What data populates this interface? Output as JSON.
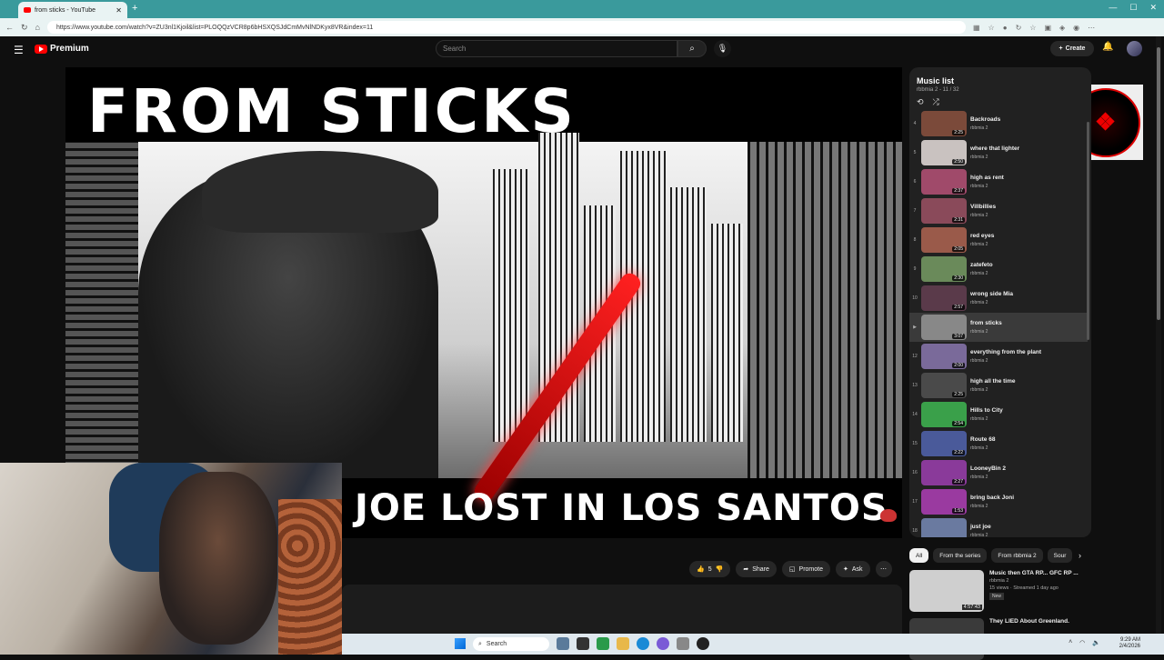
{
  "browser": {
    "tab_title": "from sticks - YouTube",
    "url": "https://www.youtube.com/watch?v=ZU3nl1Kjoil&list=PLOQQzVCR8p6bHSXQSJdCmMvNlNDKyx8VR&index=11"
  },
  "header": {
    "brand": "Premium",
    "search_placeholder": "Search",
    "create_label": "Create"
  },
  "video": {
    "title_art": "FROM STICKS",
    "subtitle_art": "JOE LOST IN LOS SANTOS"
  },
  "actions": {
    "like_count": "5",
    "share": "Share",
    "promote": "Promote",
    "ask": "Ask"
  },
  "playlist": {
    "title": "Music list",
    "subtitle": "rbbmia 2 - 11 / 32",
    "items": [
      {
        "index": "4",
        "title": "Backroads",
        "channel": "rbbmia 2",
        "duration": "2:25",
        "color": "#7b4a3a"
      },
      {
        "index": "5",
        "title": "where that lighter",
        "channel": "rbbmia 2",
        "duration": "2:50",
        "color": "#c9c2c0"
      },
      {
        "index": "6",
        "title": "high as rent",
        "channel": "rbbmia 2",
        "duration": "2:37",
        "color": "#a04a6a"
      },
      {
        "index": "7",
        "title": "Villbillies",
        "channel": "rbbmia 2",
        "duration": "2:31",
        "color": "#8a4a5a"
      },
      {
        "index": "8",
        "title": "red eyes",
        "channel": "rbbmia 2",
        "duration": "2:05",
        "color": "#9a5a4a"
      },
      {
        "index": "9",
        "title": "zatefeto",
        "channel": "rbbmia 2",
        "duration": "2:30",
        "color": "#6a8a5a"
      },
      {
        "index": "10",
        "title": "wrong side Mia",
        "channel": "rbbmia 2",
        "duration": "2:57",
        "color": "#5a3a4a"
      },
      {
        "index": "▶",
        "title": "from sticks",
        "channel": "rbbmia 2",
        "duration": "3:07",
        "color": "#888888"
      },
      {
        "index": "12",
        "title": "everything from the plant",
        "channel": "rbbmia 2",
        "duration": "2:00",
        "color": "#7a6a9a"
      },
      {
        "index": "13",
        "title": "high all the time",
        "channel": "rbbmia 2",
        "duration": "2:25",
        "color": "#4a4a4a"
      },
      {
        "index": "14",
        "title": "Hills to City",
        "channel": "rbbmia 2",
        "duration": "2:54",
        "color": "#3aa04a"
      },
      {
        "index": "15",
        "title": "Route 68",
        "channel": "rbbmia 2",
        "duration": "2:22",
        "color": "#4a5a9a"
      },
      {
        "index": "16",
        "title": "LooneyBin 2",
        "channel": "rbbmia 2",
        "duration": "2:27",
        "color": "#8a3a9a"
      },
      {
        "index": "17",
        "title": "bring back Joni",
        "channel": "rbbmia 2",
        "duration": "1:53",
        "color": "#9a3aa0"
      },
      {
        "index": "18",
        "title": "just joe",
        "channel": "rbbmia 2",
        "duration": "1:40",
        "color": "#6a7aa0"
      }
    ]
  },
  "chips": [
    "All",
    "From the series",
    "From rbbmia 2",
    "Sour"
  ],
  "related": [
    {
      "title": "Music then GTA RP... GFC RP ...",
      "channel": "rbbmia 2",
      "meta": "15 views · Streamed 1 day ago",
      "badge": "New",
      "duration": "4:57:43",
      "color": "#cfcfcf"
    },
    {
      "title": "They LIED About Greenland.",
      "channel": "",
      "meta": "",
      "badge": "",
      "duration": "",
      "color": "#3a3a3a"
    }
  ],
  "taskbar": {
    "search": "Search",
    "time": "9:29 AM",
    "date": "2/4/2026"
  }
}
